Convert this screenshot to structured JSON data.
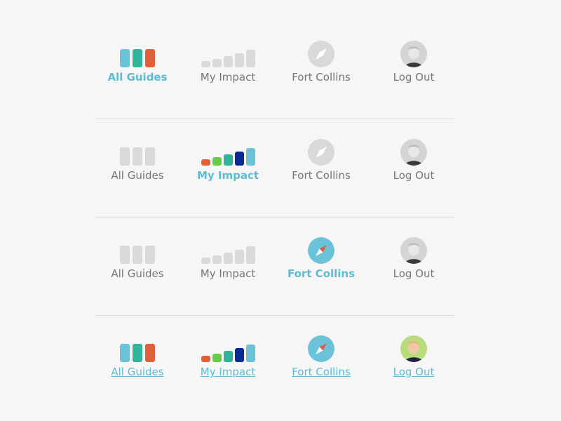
{
  "colors": {
    "accent": "#5cbcd4",
    "label_gray": "#777777",
    "icon_gray": "#d9d9d9",
    "guides": [
      "#6ac3d8",
      "#32b49a",
      "#e0603c"
    ],
    "impact": [
      "#e0603c",
      "#66cc44",
      "#32b49a",
      "#0a2a8f",
      "#6ac3d8"
    ],
    "compass_bg": "#6ac3d8",
    "compass_needle": "#e0603c",
    "avatar_active_bg": "#b7dd7a"
  },
  "rows": [
    {
      "state_note": "All Guides active",
      "items": [
        {
          "label": "All Guides",
          "icon": "guides-icon",
          "state": "active",
          "colored": true
        },
        {
          "label": "My Impact",
          "icon": "impact-icon",
          "state": "normal",
          "colored": false
        },
        {
          "label": "Fort Collins",
          "icon": "compass-icon",
          "state": "normal",
          "colored": false
        },
        {
          "label": "Log Out",
          "icon": "avatar-icon",
          "state": "normal",
          "colored": false
        }
      ]
    },
    {
      "state_note": "My Impact active",
      "items": [
        {
          "label": "All Guides",
          "icon": "guides-icon",
          "state": "normal",
          "colored": false
        },
        {
          "label": "My Impact",
          "icon": "impact-icon",
          "state": "active",
          "colored": true
        },
        {
          "label": "Fort Collins",
          "icon": "compass-icon",
          "state": "normal",
          "colored": false
        },
        {
          "label": "Log Out",
          "icon": "avatar-icon",
          "state": "normal",
          "colored": false
        }
      ]
    },
    {
      "state_note": "Fort Collins active",
      "items": [
        {
          "label": "All Guides",
          "icon": "guides-icon",
          "state": "normal",
          "colored": false
        },
        {
          "label": "My Impact",
          "icon": "impact-icon",
          "state": "normal",
          "colored": false
        },
        {
          "label": "Fort Collins",
          "icon": "compass-icon",
          "state": "active",
          "colored": true
        },
        {
          "label": "Log Out",
          "icon": "avatar-icon",
          "state": "normal",
          "colored": false
        }
      ]
    },
    {
      "state_note": "hover all",
      "items": [
        {
          "label": "All Guides",
          "icon": "guides-icon",
          "state": "hover",
          "colored": true
        },
        {
          "label": "My Impact",
          "icon": "impact-icon",
          "state": "hover",
          "colored": true
        },
        {
          "label": "Fort Collins",
          "icon": "compass-icon",
          "state": "hover",
          "colored": true
        },
        {
          "label": "Log Out",
          "icon": "avatar-icon",
          "state": "hover",
          "colored": true
        }
      ]
    }
  ]
}
